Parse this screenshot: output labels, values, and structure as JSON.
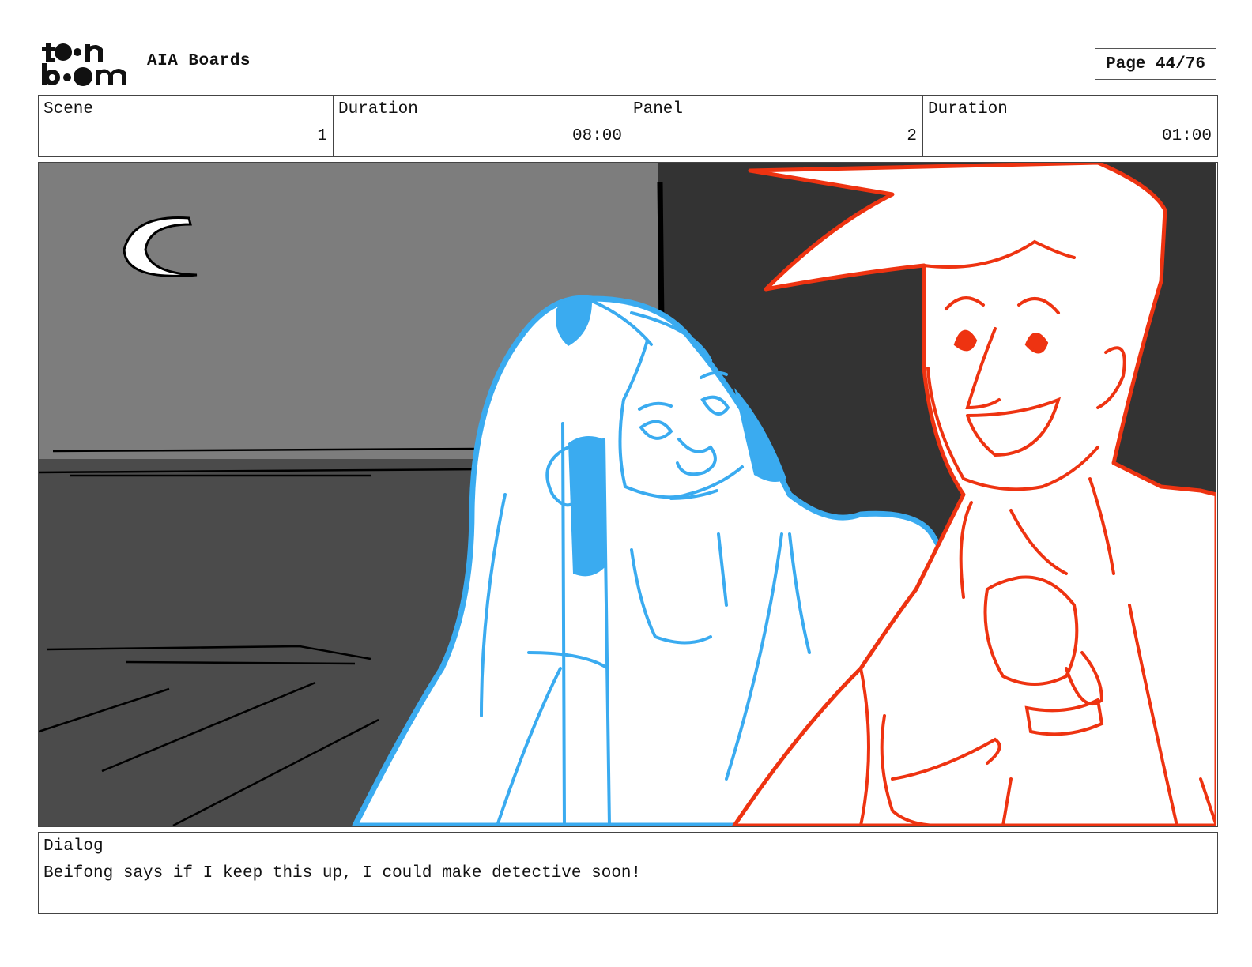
{
  "header": {
    "logo_text": "toon boom",
    "title": "AIA Boards",
    "page_label": "Page 44/76"
  },
  "info": {
    "scene_label": "Scene",
    "scene_value": "1",
    "scene_duration_label": "Duration",
    "scene_duration_value": "08:00",
    "panel_label": "Panel",
    "panel_value": "2",
    "panel_duration_label": "Duration",
    "panel_duration_value": "01:00"
  },
  "panel_image": {
    "subject": "storyboard-sketch",
    "colors": {
      "sky": "#7d7d7d",
      "ground": "#4b4b4b",
      "wall": "#333333",
      "girl_line": "#3aabf0",
      "boy_line": "#ee3311"
    }
  },
  "dialog": {
    "label": "Dialog",
    "text": "Beifong says if I keep this up, I could make detective soon!"
  }
}
